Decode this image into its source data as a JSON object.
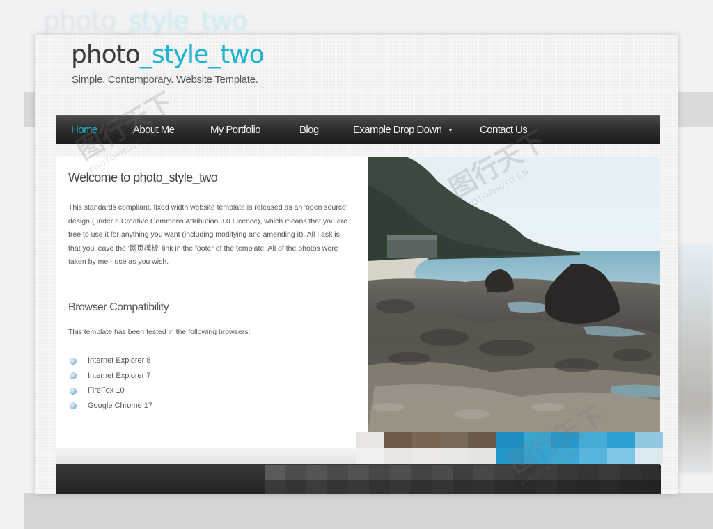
{
  "site": {
    "logo_prefix": "photo",
    "logo_accent": "_style_two",
    "slogan": "Simple. Contemporary. Website Template."
  },
  "nav": {
    "items": [
      {
        "label": "Home",
        "active": true
      },
      {
        "label": "About Me"
      },
      {
        "label": "My Portfolio"
      },
      {
        "label": "Blog"
      },
      {
        "label": "Example Drop Down",
        "has_dropdown": true
      },
      {
        "label": "Contact Us"
      }
    ]
  },
  "content": {
    "heading": "Welcome to photo_style_two",
    "intro": "This standards compliant, fixed width website template is released as an 'open source' design (under a Creative Commons Attribution 3.0 Licence), which means that you are free to use it for anything you want (including modifying and amending it). All I ask is that you leave the '网页模板' link in the footer of the template. All of the photos were taken by me - use as you wish.",
    "compat_heading": "Browser Compatibility",
    "compat_intro": "This template has been tested in the following browsers:",
    "browsers": [
      "Internet Explorer 8",
      "Internet Explorer 7",
      "FireFox 10",
      "Google Chrome 17"
    ]
  },
  "watermark": {
    "logo_text": "图行天下",
    "url": "PHOTOPHOTO.CN"
  },
  "colors": {
    "accent": "#1fb3d2",
    "nav_bg": "#2b2b2b",
    "text": "#555555"
  }
}
